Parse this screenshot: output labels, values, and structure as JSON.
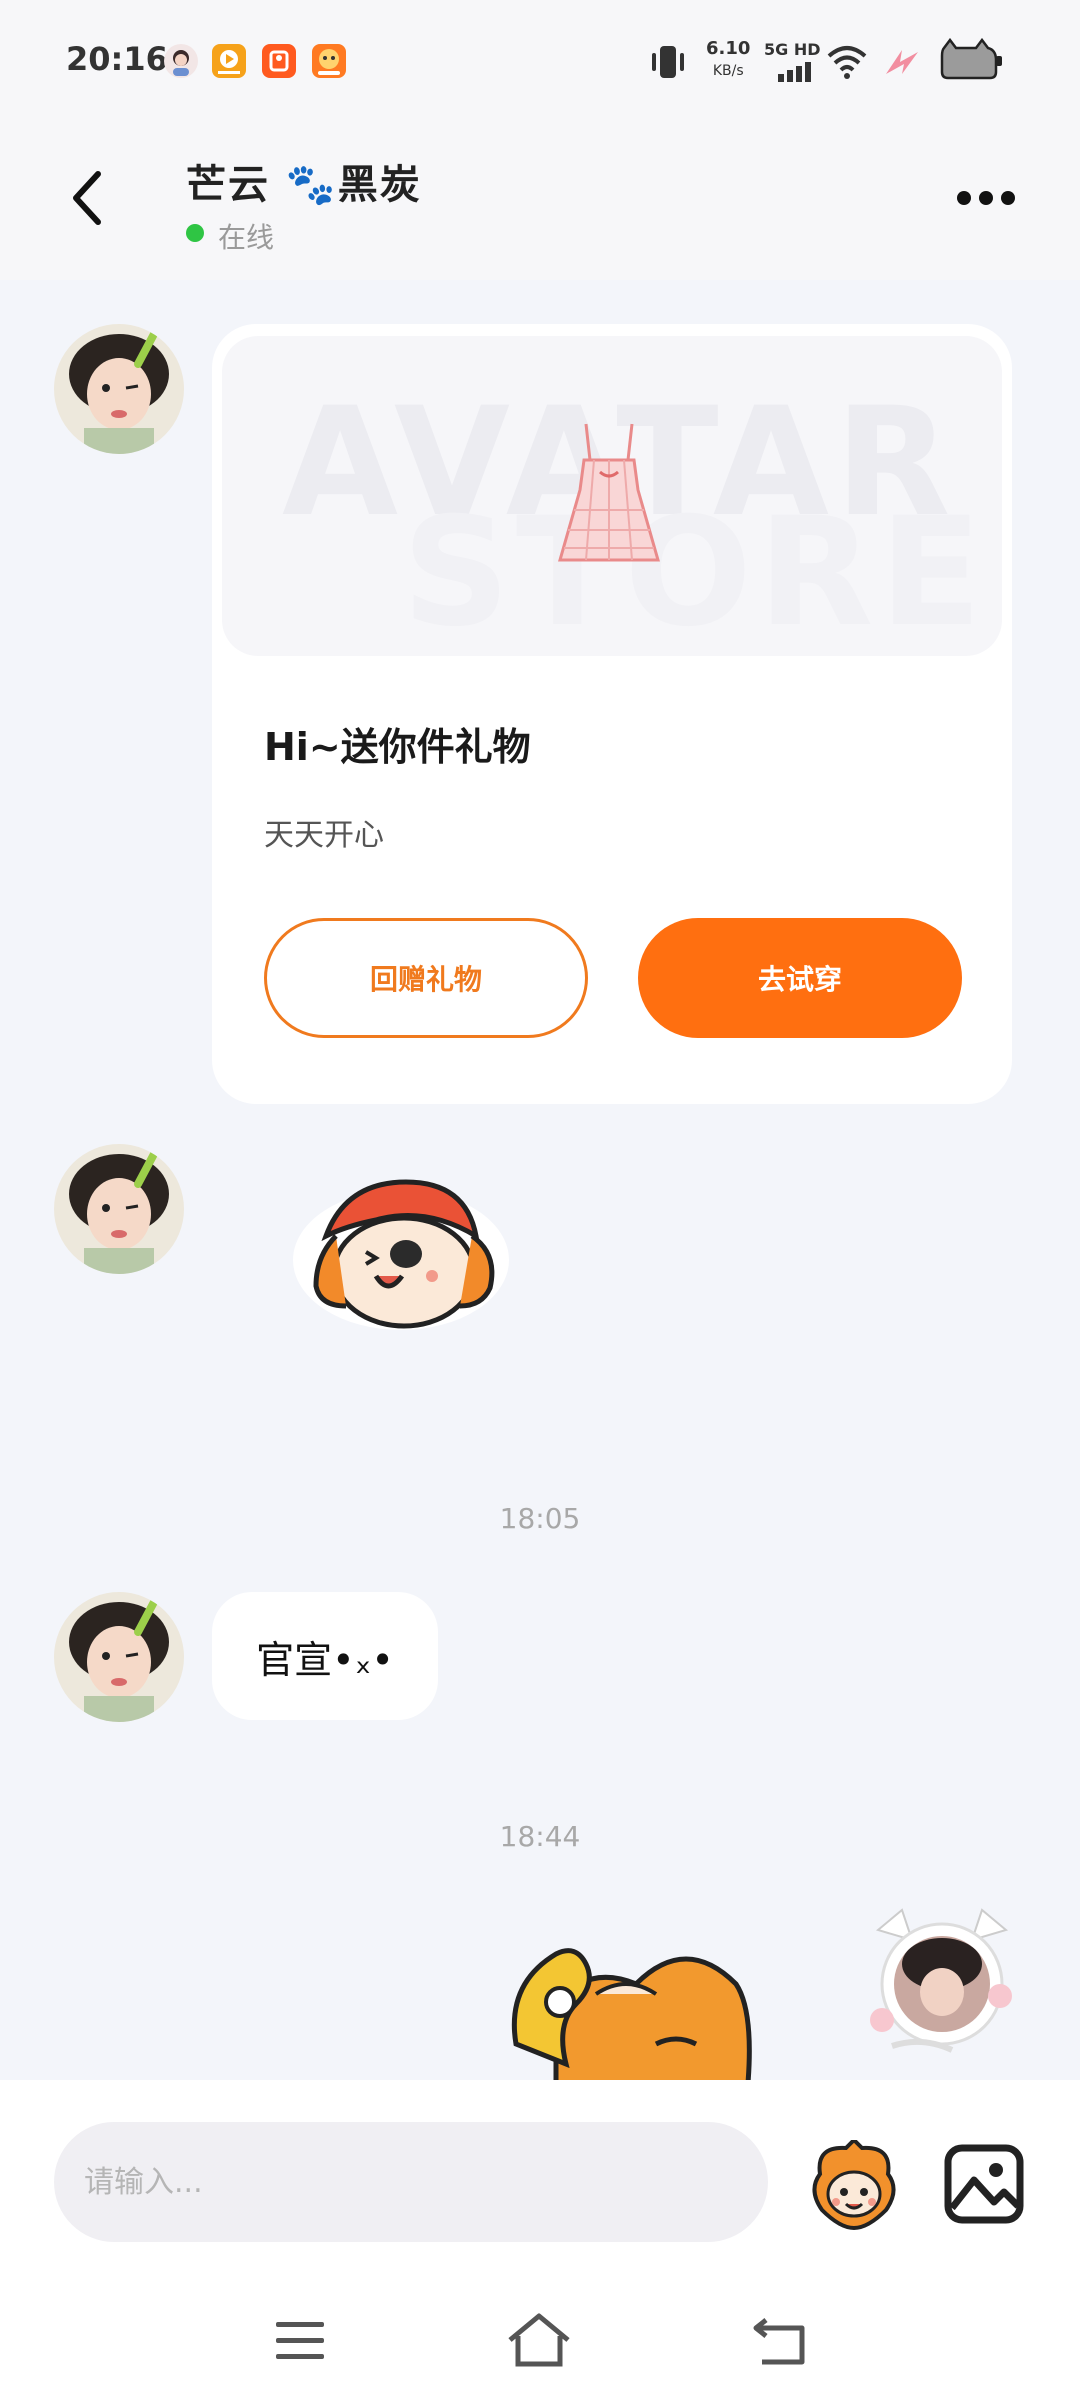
{
  "status_bar": {
    "time": "20:16",
    "net_speed_value": "6.10",
    "net_speed_unit": "KB/s",
    "network": "5G HD"
  },
  "header": {
    "contact_name": "芒云 🐾黑炭",
    "status": "在线"
  },
  "gift_card": {
    "watermark_line1": "AVATAR",
    "watermark_line2": "STORE",
    "title": "Hi~送你件礼物",
    "subtitle": "天天开心",
    "return_gift_label": "回赠礼物",
    "try_on_label": "去试穿"
  },
  "messages": {
    "timestamp_1": "18:05",
    "text_message": "官宣•ₓ•",
    "timestamp_2": "18:44"
  },
  "input": {
    "placeholder": "请输入..."
  },
  "colors": {
    "accent_orange": "#ff6f10",
    "online_green": "#2fc544",
    "chat_background": "#f3f5fa"
  }
}
